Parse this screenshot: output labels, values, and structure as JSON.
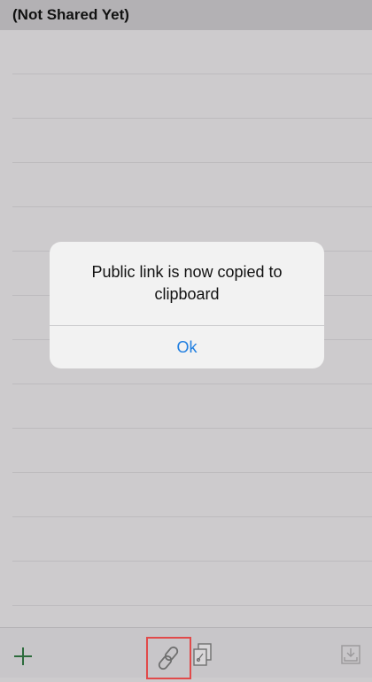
{
  "header": {
    "title": "(Not Shared Yet)"
  },
  "alert": {
    "message": "Public link is now copied to clipboard",
    "ok_label": "Ok"
  },
  "toolbar": {
    "icons": [
      "plus-icon",
      "link-icon",
      "copy-document-icon",
      "download-tray-icon"
    ],
    "accent": "#2d6b3c",
    "highlight_color": "#e14a4a"
  },
  "colors": {
    "ok_text": "#1f7ee0"
  }
}
